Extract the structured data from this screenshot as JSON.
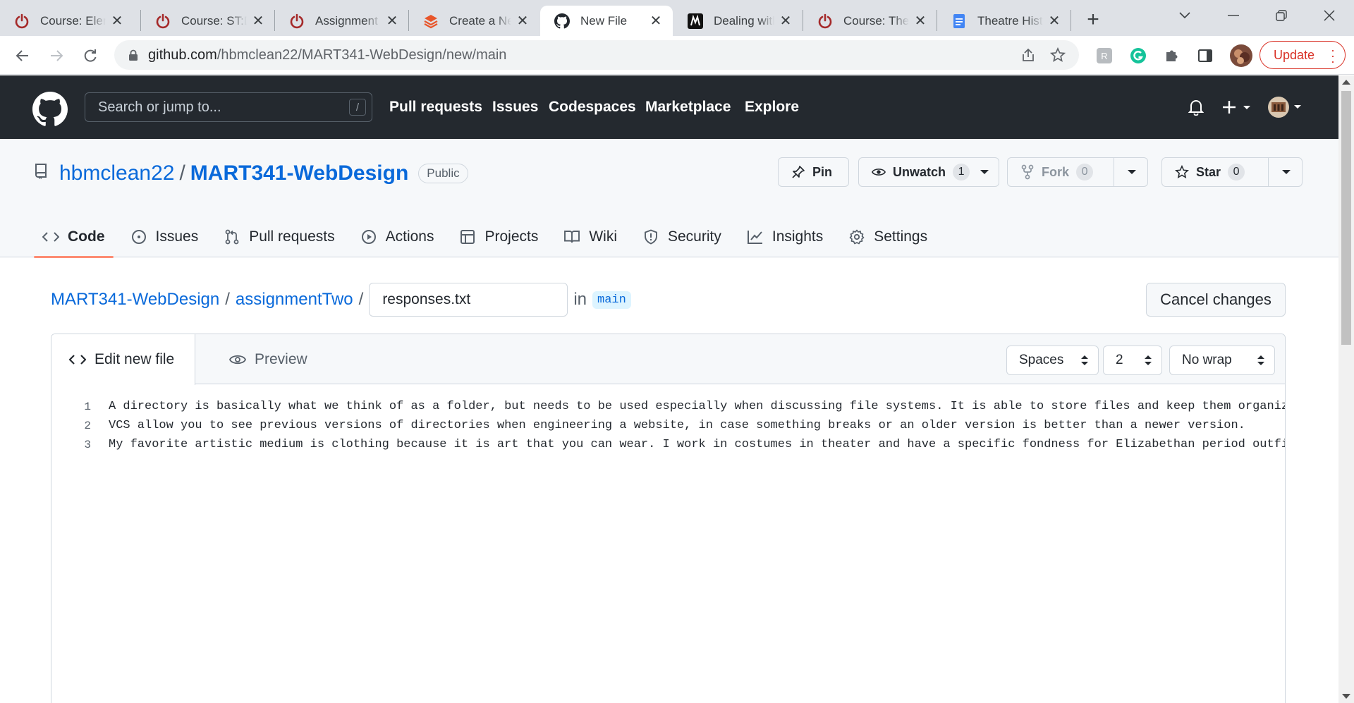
{
  "browser": {
    "tabs": [
      {
        "title": "Course: Elementary",
        "favicon": "power-icon",
        "active": false
      },
      {
        "title": "Course: ST:Digital",
        "favicon": "power-icon",
        "active": false
      },
      {
        "title": "Assignment",
        "favicon": "power-icon",
        "active": false
      },
      {
        "title": "Create a New",
        "favicon": "layers-icon",
        "active": false
      },
      {
        "title": "New File",
        "favicon": "github-icon",
        "active": true
      },
      {
        "title": "Dealing with",
        "favicon": "m-logo-icon",
        "active": false
      },
      {
        "title": "Course: The",
        "favicon": "power-icon",
        "active": false
      },
      {
        "title": "Theatre History",
        "favicon": "docs-icon",
        "active": false
      }
    ],
    "new_tab": "+",
    "url_host": "github.com",
    "url_path": "/hbmclean22/MART341-WebDesign/new/main",
    "update_label": "Update",
    "colors": {
      "update": "#d93025",
      "tabstrip": "#dee1e6"
    }
  },
  "gh_header": {
    "search_placeholder": "Search or jump to...",
    "search_key": "/",
    "nav": [
      "Pull requests",
      "Issues",
      "Codespaces",
      "Marketplace",
      "Explore"
    ]
  },
  "repo": {
    "owner": "hbmclean22",
    "separator": "/",
    "name": "MART341-WebDesign",
    "visibility": "Public",
    "pin_label": "Pin",
    "watch_label": "Unwatch",
    "watch_count": "1",
    "fork_label": "Fork",
    "fork_count": "0",
    "star_label": "Star",
    "star_count": "0",
    "tabs": [
      {
        "label": "Code",
        "icon": "code-icon",
        "active": true
      },
      {
        "label": "Issues",
        "icon": "issue-icon",
        "active": false
      },
      {
        "label": "Pull requests",
        "icon": "pull-request-icon",
        "active": false
      },
      {
        "label": "Actions",
        "icon": "play-icon",
        "active": false
      },
      {
        "label": "Projects",
        "icon": "table-icon",
        "active": false
      },
      {
        "label": "Wiki",
        "icon": "book-icon",
        "active": false
      },
      {
        "label": "Security",
        "icon": "shield-icon",
        "active": false
      },
      {
        "label": "Insights",
        "icon": "graph-icon",
        "active": false
      },
      {
        "label": "Settings",
        "icon": "gear-icon",
        "active": false
      }
    ],
    "accent": "#fd8c73"
  },
  "editor_page": {
    "crumb_repo": "MART341-WebDesign",
    "crumb_folder": "assignmentTwo",
    "filename": "responses.txt",
    "in_label": "in",
    "branch": "main",
    "cancel_label": "Cancel changes",
    "edit_tab": "Edit new file",
    "preview_tab": "Preview",
    "indent_mode": "Spaces",
    "indent_size": "2",
    "wrap_mode": "No wrap",
    "lines": [
      {
        "num": "1",
        "text": "A directory is basically what we think of as a folder, but needs to be used especially when discussing file systems. It is able to store files and keep them organized i"
      },
      {
        "num": "2",
        "text": "VCS allow you to see previous versions of directories when engineering a website, in case something breaks or an older version is better than a newer version."
      },
      {
        "num": "3",
        "text": "My favorite artistic medium is clothing because it is art that you can wear. I work in costumes in theater and have a specific fondness for Elizabethan period outfits b"
      }
    ]
  }
}
